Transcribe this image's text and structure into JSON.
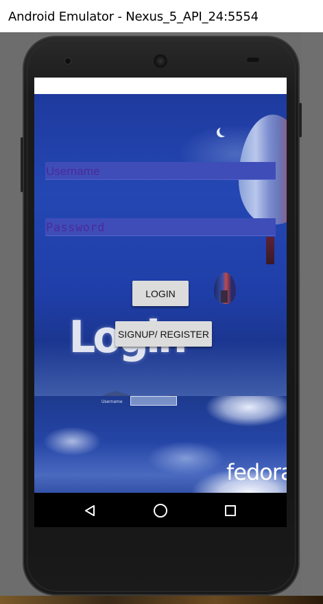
{
  "window": {
    "title": "Android Emulator - Nexus_5_API_24:5554"
  },
  "wallpaper": {
    "logo_text": "Login",
    "mini_username_label": "Username",
    "brand_text": "fedora"
  },
  "form": {
    "username_placeholder": "Username",
    "password_placeholder": "Password",
    "login_label": "LOGIN",
    "signup_label": "SIGNUP/ REGISTER"
  },
  "navbar": {
    "back_icon": "back-triangle-icon",
    "home_icon": "home-circle-icon",
    "recents_icon": "recents-square-icon"
  },
  "colors": {
    "field_bg": "#3f4db8",
    "button_bg": "#dcdcdc",
    "wallpaper_primary": "#2447b3"
  }
}
